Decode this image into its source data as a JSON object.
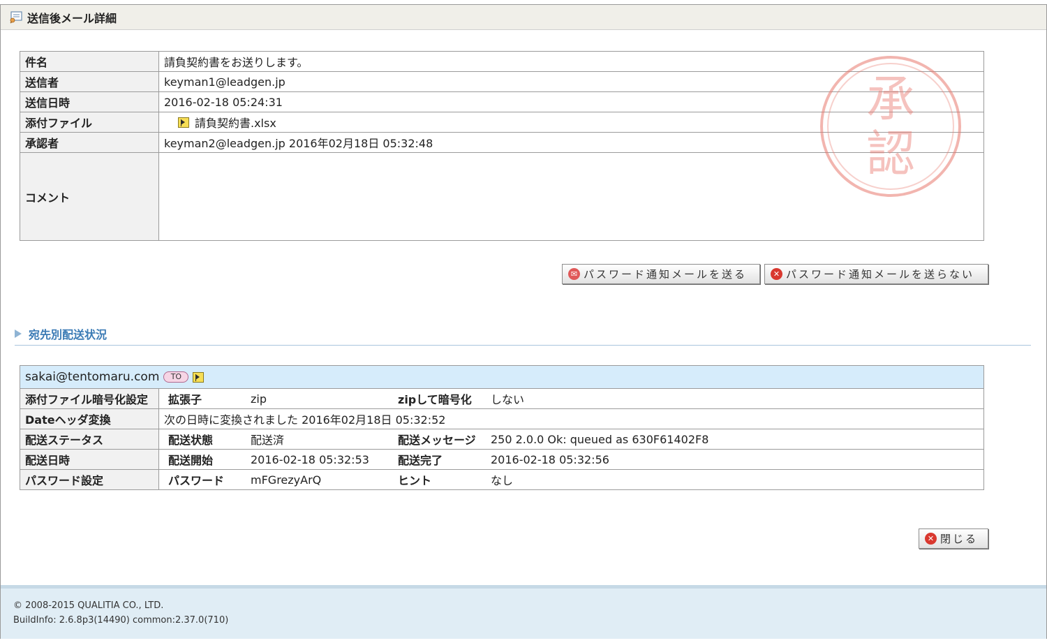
{
  "window": {
    "title": "送信後メール詳細",
    "icon": "mail-detail-icon"
  },
  "detail": {
    "subject_label": "件名",
    "subject": "請負契約書をお送りします。",
    "sender_label": "送信者",
    "sender": "keyman1@leadgen.jp",
    "sent_at_label": "送信日時",
    "sent_at": "2016-02-18 05:24:31",
    "attachment_label": "添付ファイル",
    "attachment": "請負契約書.xlsx",
    "approver_label": "承認者",
    "approver": "keyman2@leadgen.jp 2016年02月18日 05:32:48",
    "comment_label": "コメント",
    "comment": ""
  },
  "stamp": {
    "text_top": "承",
    "text_bottom": "認",
    "color": "#e8786e"
  },
  "buttons": {
    "send_password": "パスワード通知メールを送る",
    "dont_send_password": "パスワード通知メールを送らない",
    "close": "閉じる"
  },
  "section": {
    "title": "宛先別配送状況"
  },
  "delivery": {
    "recipient": "sakai@tentomaru.com",
    "recipient_type": "TO",
    "encryption_label": "添付ファイル暗号化設定",
    "extension_key": "拡張子",
    "extension_value": "zip",
    "zip_encrypt_key": "zipして暗号化",
    "zip_encrypt_value": "しない",
    "date_header_label": "Dateヘッダ変換",
    "date_header_value": "次の日時に変換されました 2016年02月18日 05:32:52",
    "status_label": "配送ステータス",
    "status_key": "配送状態",
    "status_value": "配送済",
    "message_key": "配送メッセージ",
    "message_value": "250 2.0.0 Ok: queued as 630F61402F8",
    "delivery_time_label": "配送日時",
    "start_key": "配送開始",
    "start_value": "2016-02-18 05:32:53",
    "end_key": "配送完了",
    "end_value": "2016-02-18 05:32:56",
    "password_label": "パスワード設定",
    "password_key": "パスワード",
    "password_value": "mFGrezyArQ",
    "hint_key": "ヒント",
    "hint_value": "なし"
  },
  "footer": {
    "copyright": "© 2008-2015 QUALITIA CO., LTD.",
    "build": "BuildInfo: 2.6.8p3(14490) common:2.37.0(710)"
  }
}
